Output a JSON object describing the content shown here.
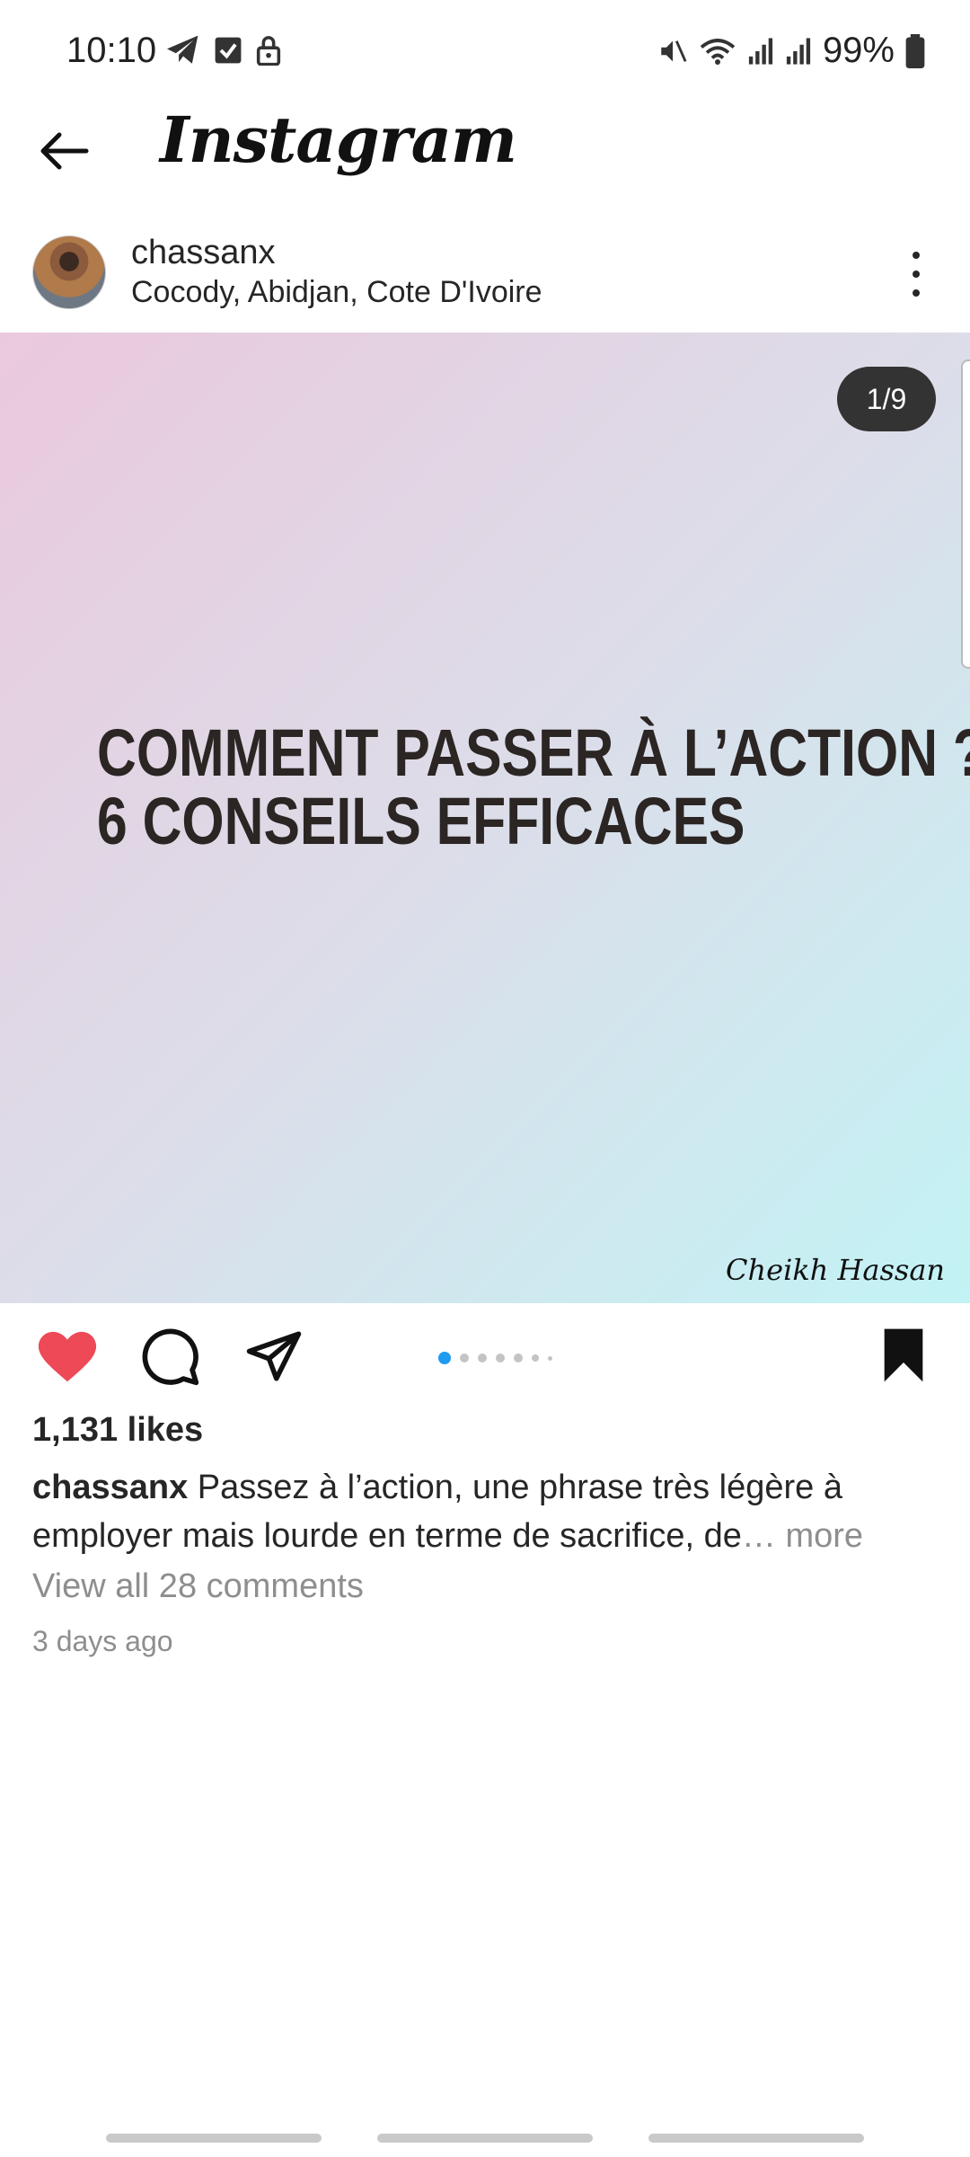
{
  "status_bar": {
    "time": "10:10",
    "battery": "99%",
    "left_icons": [
      "telegram-icon",
      "checkbox-icon",
      "lock-icon"
    ],
    "right_icons": [
      "mute-icon",
      "wifi-icon",
      "signal-icon",
      "signal-icon",
      "battery-icon"
    ]
  },
  "app_bar": {
    "title": "Instagram"
  },
  "post": {
    "username": "chassanx",
    "location": "Cocody, Abidjan, Cote D'Ivoire",
    "slide_counter": "1/9",
    "headline_line1": "COMMENT PASSER À L’ACTION ?",
    "headline_line2": "6 CONSEILS EFFICACES",
    "signature": "Cheikh Hassan",
    "likes": "1,131 likes",
    "caption_user": "chassanx",
    "caption_text": " Passez à l’action, une phrase très légère à employer mais lourde en terme de sacrifice, de",
    "caption_more": "… more",
    "comments_link": "View all 28 comments",
    "posted_ago": "3 days ago",
    "current_slide": 1,
    "total_slides": 9
  },
  "colors": {
    "like_red": "#ed4956",
    "active_dot": "#1d9bf0"
  }
}
